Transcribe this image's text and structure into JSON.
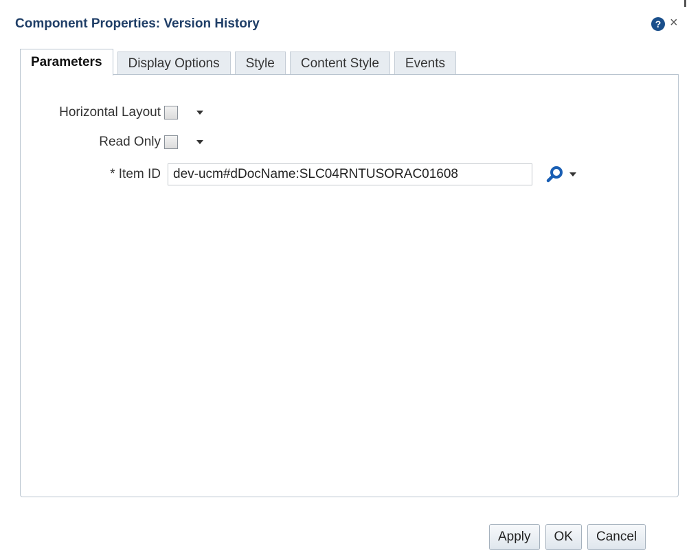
{
  "dialog": {
    "title": "Component Properties: Version History",
    "help_icon": "question-circle-icon",
    "help_glyph": "?",
    "close_icon": "close-icon",
    "close_glyph": "×"
  },
  "tabs": [
    {
      "label": "Parameters",
      "active": true
    },
    {
      "label": "Display Options",
      "active": false
    },
    {
      "label": "Style",
      "active": false
    },
    {
      "label": "Content Style",
      "active": false
    },
    {
      "label": "Events",
      "active": false
    }
  ],
  "form": {
    "horizontal_layout": {
      "label": "Horizontal Layout",
      "checked": false
    },
    "read_only": {
      "label": "Read Only",
      "checked": false
    },
    "item_id": {
      "label": "* Item ID",
      "value": "dev-ucm#dDocName:SLC04RNTUSORAC01608"
    }
  },
  "footer": {
    "apply_label": "Apply",
    "ok_label": "OK",
    "cancel_label": "Cancel"
  },
  "colors": {
    "title": "#1f3e67",
    "accent": "#1a5fb4"
  }
}
